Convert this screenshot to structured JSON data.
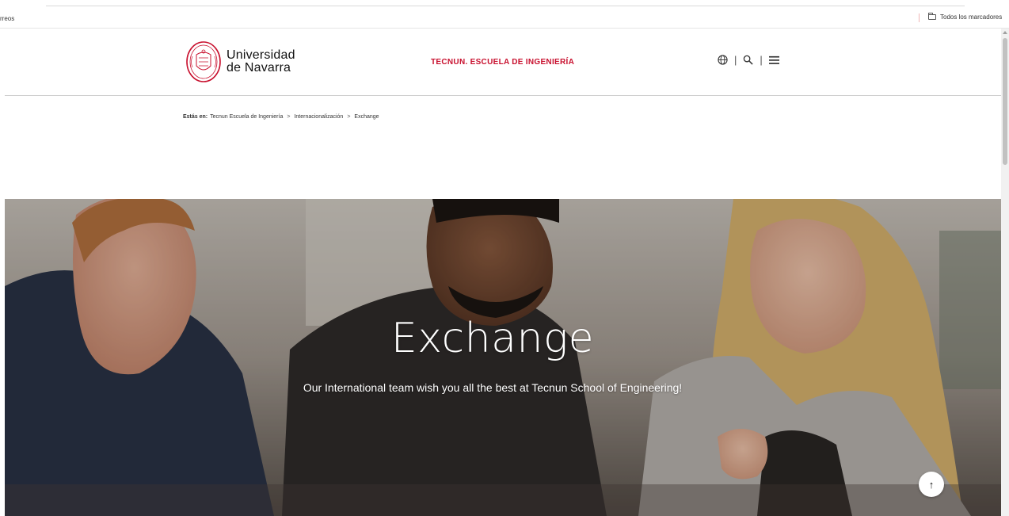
{
  "browser": {
    "bookmarks_left": "rreos",
    "bookmarks_right": "Todos los marcadores"
  },
  "header": {
    "logo_line1": "Universidad",
    "logo_line2": "de Navarra",
    "school_name": "TECNUN. ESCUELA DE INGENIERÍA",
    "tool_separator": "|",
    "brand_color": "#c8102e"
  },
  "breadcrumb": {
    "label": "Estás en:",
    "items": [
      "Tecnun Escuela de Ingeniería",
      "Internacionalización",
      "Exchange"
    ],
    "separator": ">"
  },
  "hero": {
    "title": "Exchange",
    "subtitle": "Our International team wish you all the best at Tecnun School of Engineering!"
  },
  "icons": {
    "language": "globe-icon",
    "search": "search-icon",
    "menu": "hamburger-menu-icon",
    "back_to_top": "arrow-up-icon",
    "bookmarks_folder": "folder-icon"
  },
  "back_to_top_symbol": "↑"
}
